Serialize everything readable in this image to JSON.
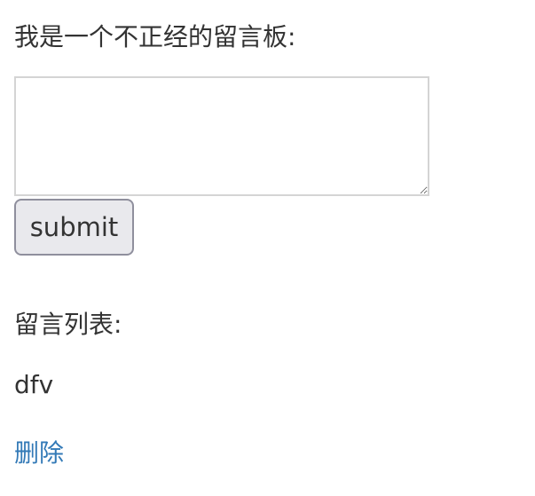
{
  "form": {
    "title": "我是一个不正经的留言板:",
    "message_value": "",
    "submit_label": "submit"
  },
  "list": {
    "title": "留言列表:",
    "messages": [
      {
        "text": "dfv",
        "delete_label": "删除"
      }
    ]
  },
  "colors": {
    "link": "#337ab7",
    "text": "#333333",
    "button_bg": "#e9e9ed"
  }
}
